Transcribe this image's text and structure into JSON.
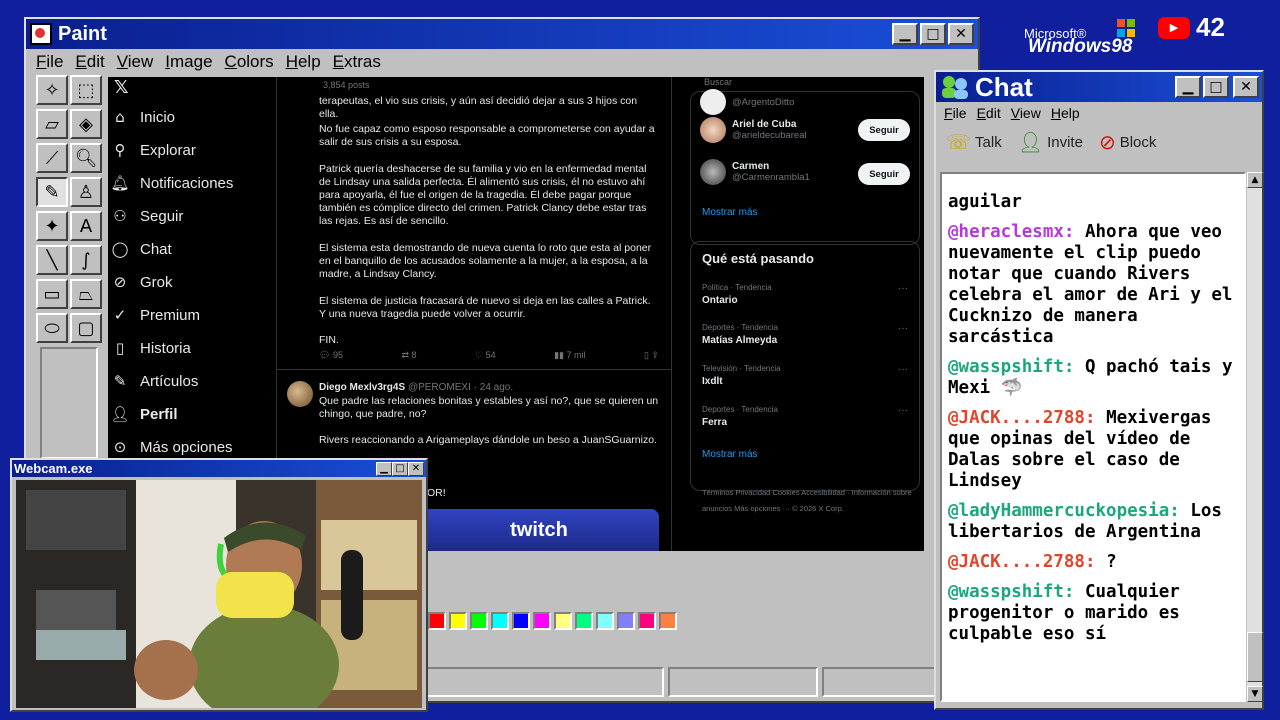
{
  "paint": {
    "title": "Paint",
    "menu": [
      "File",
      "Edit",
      "View",
      "Image",
      "Colors",
      "Help",
      "Extras"
    ],
    "palette": [
      "#ff0000",
      "#ffff00",
      "#00ff00",
      "#00ffff",
      "#0000ff",
      "#ff00ff",
      "#ffff80",
      "#00ff80",
      "#80ffff",
      "#8080ff",
      "#ff0080",
      "#ff8040"
    ]
  },
  "twitter": {
    "nav": [
      "Inicio",
      "Explorar",
      "Notificaciones",
      "Seguir",
      "Chat",
      "Grok",
      "Premium",
      "Historia",
      "Artículos",
      "Perfil",
      "Más opciones"
    ],
    "header_posts": "3,854 posts",
    "post_paragraphs": [
      "terapeutas, el vio sus crisis, y aún así decidió dejar a sus 3 hijos con ella.",
      "No fue capaz como esposo responsable a comprometerse con ayudar a salir de sus crisis a su esposa.",
      "Patrick quería deshacerse de su familia y vio en la enfermedad mental de Lindsay una salida perfecta. Él alimentó sus crisis, él no estuvo ahí para apoyarla, él fue el origen de la tragedia. Él debe pagar porque también es cómplice directo del crimen. Patrick Clancy debe estar tras las rejas. Es así de sencillo.",
      "El sistema esta demostrando de nueva cuenta lo roto que esta al poner en el banquillo de los acusados solamente a la mujer, a la esposa, a la madre, a Lindsay Clancy.",
      "El sistema de justicia fracasará de nuevo si deja en las calles a Patrick. Y una nueva tragedia puede volver a ocurrir.",
      "FIN."
    ],
    "post_stats": {
      "replies": "95",
      "reposts": "8",
      "likes": "54",
      "views": "7 mil"
    },
    "post2": {
      "name": "Diego Mexlv3rg4S",
      "handle": "@PEROMEXI · 24 ago.",
      "text1": "Que padre las relaciones bonitas y estables y así no?, que se quieren un chingo, que padre, no?",
      "text2": "Rivers reaccionando a Arigameplays dándole un beso a JuanSGuarnizo.",
      "text3": "OR!",
      "media_label": "twitch"
    },
    "search_placeholder": "Buscar",
    "partial_handle": "@ArgentoDitto",
    "follow_suggestions": [
      {
        "name": "Ariel de Cuba",
        "handle": "@arieldecubareal",
        "button": "Seguir"
      },
      {
        "name": "Carmen",
        "handle": "@Carmenrambla1",
        "button": "Seguir"
      }
    ],
    "show_more": "Mostrar más",
    "trends_title": "Qué está pasando",
    "trends": [
      {
        "category": "Política · Tendencia",
        "name": "Ontario"
      },
      {
        "category": "Deportes · Tendencia",
        "name": "Matías Almeyda"
      },
      {
        "category": "Televisión · Tendencia",
        "name": "Ixdlt"
      },
      {
        "category": "Deportes · Tendencia",
        "name": "Ferra"
      }
    ],
    "footer": "Términos   Privacidad   Cookies   Accesibilidad   ·   Información sobre anuncios   Más opciones ···   © 2026 X Corp."
  },
  "webcam": {
    "title": "Webcam.exe"
  },
  "chat": {
    "title": "Chat",
    "menu": [
      "File",
      "Edit",
      "View",
      "Help"
    ],
    "toolbar": [
      "Talk",
      "Invite",
      "Block"
    ],
    "messages": [
      {
        "user": "",
        "text": "aguilar"
      },
      {
        "user": "@heraclesmx:",
        "text": "Ahora que veo nuevamente el clip puedo notar que cuando Rivers celebra el amor de Ari y el Cucknizo de manera sarcástica"
      },
      {
        "user": "@wasspshift:",
        "text": "Q pachó tais y Mexi 🦈"
      },
      {
        "user": "@JACK....2788:",
        "text": "Mexivergas que opinas del vídeo de Dalas sobre el caso de Lindsey"
      },
      {
        "user": "@ladyHammercuckopesia:",
        "text": "Los libertarios de Argentina"
      },
      {
        "user": "@JACK....2788:",
        "text": "?"
      },
      {
        "user": "@wasspshift:",
        "text": "Cualquier progenitor o marido es culpable eso sí"
      }
    ]
  },
  "brand": {
    "microsoft": "Microsoft®",
    "windows": "Windows98",
    "subscriber_count": "42"
  }
}
